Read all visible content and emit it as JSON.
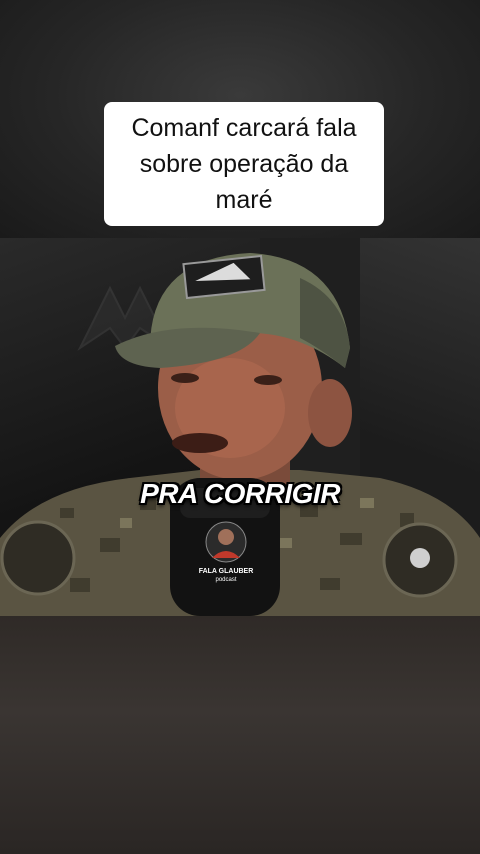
{
  "caption": {
    "text": "Comanf carcará fala sobre operação da maré"
  },
  "video": {
    "subtitle": "PRA CORRIGIR",
    "podcast_logo": {
      "line1": "FALA GLAUBER",
      "line2": "podcast"
    }
  },
  "colors": {
    "caption_bg": "#ffffff",
    "caption_text": "#111111",
    "subtitle_text": "#ffffff",
    "subtitle_outline": "#000000"
  }
}
